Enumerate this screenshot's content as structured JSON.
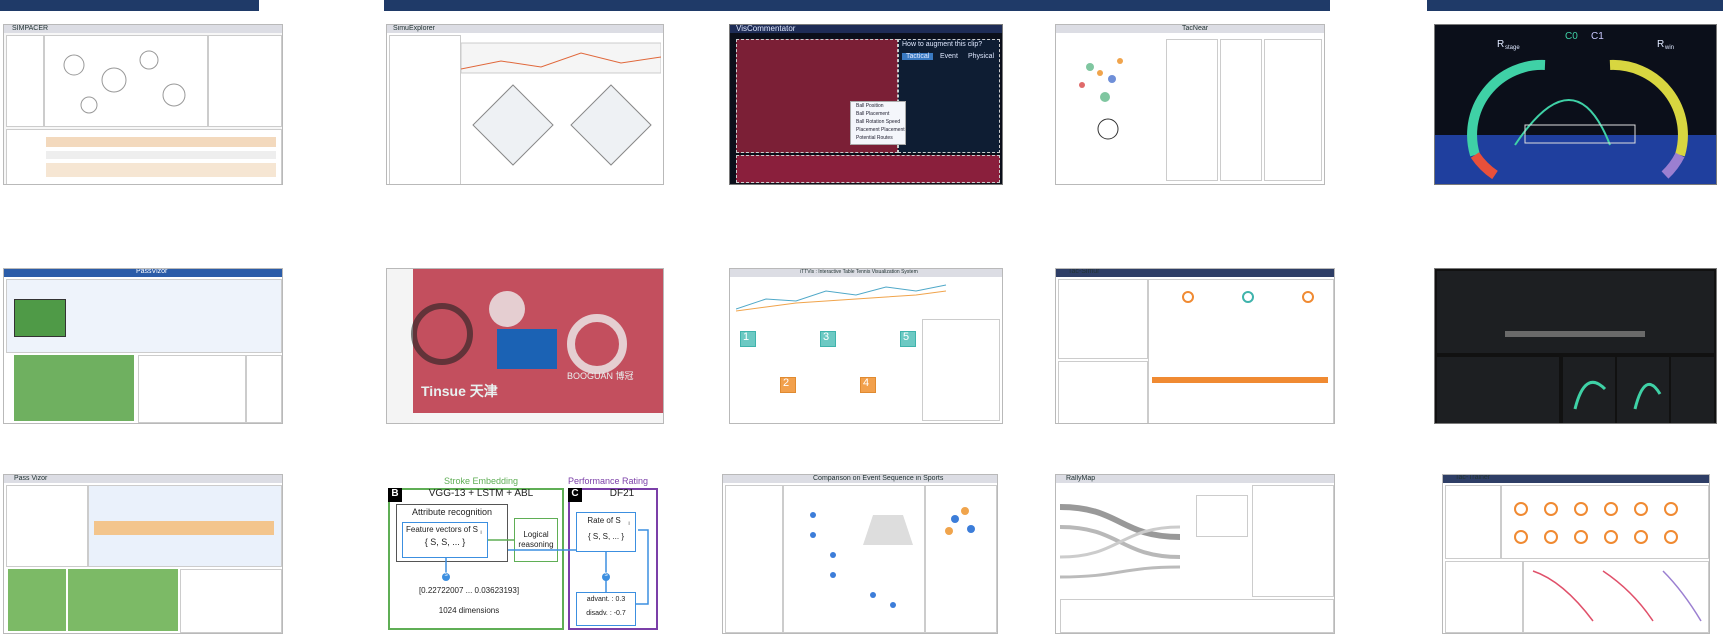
{
  "header_bars": [
    "bar-left",
    "bar-center",
    "bar-right"
  ],
  "tiles": {
    "r1c1": {
      "title": "SIMPACER"
    },
    "r1c2": {
      "title": "SimuExplorer"
    },
    "r1c3": {
      "title": "VisCommentator",
      "question": "How to augment this clip?",
      "menu": [
        "Tactical",
        "Event",
        "Physical"
      ],
      "rows": [
        "Ball Position",
        "Ball Placement",
        "Ball Rotation Speed",
        "Placement Placement",
        "Potential Routes"
      ]
    },
    "r1c4": {
      "title": "TacNear"
    },
    "r1c5": {
      "legend": [
        "C0",
        "C1"
      ],
      "label_left": "R",
      "label_left_sub": "stage",
      "label_right": "R",
      "label_right_sub": "win"
    },
    "r2c1": {
      "title": "PassVizor"
    },
    "r2c2": {
      "banner1": "Tinsue 天津",
      "banner2": "BOOGUAN 博冠"
    },
    "r2c3": {
      "title": "iTTVis : Interactive Table Tennis Visualization System",
      "numbers": [
        "1",
        "2",
        "3",
        "4",
        "5"
      ]
    },
    "r2c4": {
      "title": "Tac-Simur"
    },
    "r2c5": {},
    "r3c1": {
      "title": "Pass Vizor"
    },
    "r3c2": {
      "stroke_title": "Stroke Embedding",
      "perf_title": "Performance Rating",
      "B": "B",
      "C": "C",
      "vgg": "VGG-13 + LSTM + ABL",
      "df21": "DF21",
      "attr": "Attribute recognition",
      "feat1": "Feature vectors of S",
      "feat1_sub": "i",
      "feat2": "{ S",
      "feat2_rest": ", S",
      "feat2_end": ", ... }",
      "logical1": "Logical",
      "logical2": "reasoning",
      "rate1": "Rate of S",
      "rate1_sub": "i",
      "rate2": "{ S",
      "rate2_rest": ", S",
      "rate2_end": ", ... }",
      "vector": "[0.22722007  ...  0.03623193]",
      "dims": "1024 dimensions",
      "adv": "advant. : 0.3",
      "disadv": "disadv. : -0.7",
      "s_label": "S"
    },
    "r3c3": {
      "title": "Comparison on Event Sequence in Sports"
    },
    "r3c4": {
      "title": "RallyMap"
    },
    "r3c5": {
      "title": "Tac-Trainer"
    }
  }
}
